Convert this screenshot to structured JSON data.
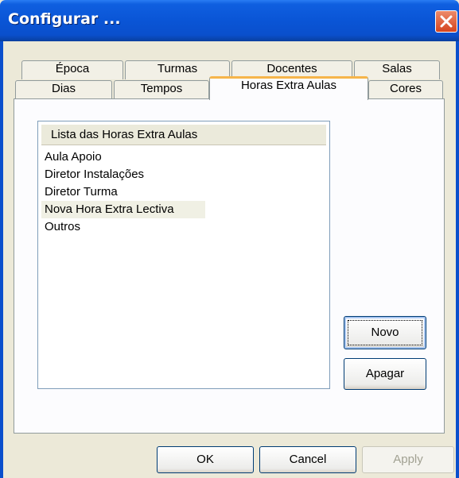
{
  "window": {
    "title": "Configurar ..."
  },
  "tabs_back": [
    {
      "label": "Época"
    },
    {
      "label": "Turmas"
    },
    {
      "label": "Docentes"
    },
    {
      "label": "Salas"
    }
  ],
  "tabs_front": [
    {
      "label": "Dias"
    },
    {
      "label": "Tempos"
    },
    {
      "label": "Horas Extra Aulas"
    },
    {
      "label": "Cores"
    }
  ],
  "list": {
    "header": "Lista das Horas Extra Aulas",
    "items": [
      {
        "label": "Aula Apoio"
      },
      {
        "label": "Diretor Instalações"
      },
      {
        "label": "Diretor Turma"
      },
      {
        "label": "Nova Hora Extra Lectiva"
      },
      {
        "label": "Outros"
      }
    ],
    "selected_index": 3
  },
  "buttons": {
    "novo": "Novo",
    "apagar": "Apagar",
    "ok": "OK",
    "cancel": "Cancel",
    "apply": "Apply"
  },
  "colors": {
    "titlebar": "#0a55d6",
    "active_tab_accent": "#f6b54a",
    "close_button": "#d5441e"
  }
}
